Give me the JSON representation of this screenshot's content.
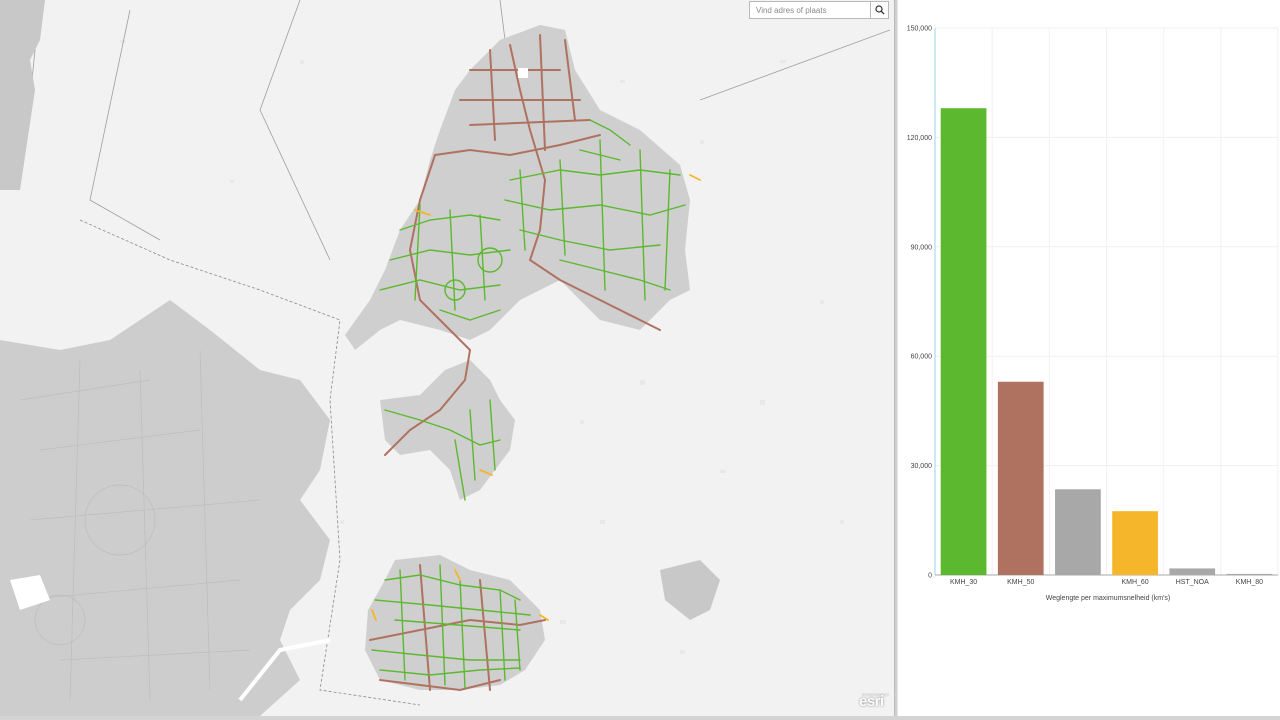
{
  "search": {
    "placeholder": "Vind adres of plaats",
    "icon": "search-icon"
  },
  "map": {
    "attribution_logo": "esri",
    "attribution_small": "POWERED BY",
    "road_colors": {
      "KMH_30": "#5cb82f",
      "KMH_50": "#b07260",
      "KMH_60": "#f5b62b"
    }
  },
  "chart_data": {
    "type": "bar",
    "categories": [
      "KMH_30",
      "KMH_50",
      "",
      "KMH_60",
      "HST_NOA",
      "KMH_80"
    ],
    "values": [
      128000,
      53000,
      23500,
      17500,
      1800,
      300
    ],
    "colors": [
      "#5cb82f",
      "#b07260",
      "#a8a8a8",
      "#f5b62b",
      "#a8a8a8",
      "#a8a8a8"
    ],
    "xlabel": "Weglengte per maximumsnelheid (km's)",
    "ylabel": "",
    "ylim": [
      0,
      150000
    ],
    "yticks": [
      "0",
      "30,000",
      "60,000",
      "90,000",
      "120,000",
      "150,000"
    ],
    "ytick_values": [
      0,
      30000,
      60000,
      90000,
      120000,
      150000
    ],
    "grid": true
  }
}
